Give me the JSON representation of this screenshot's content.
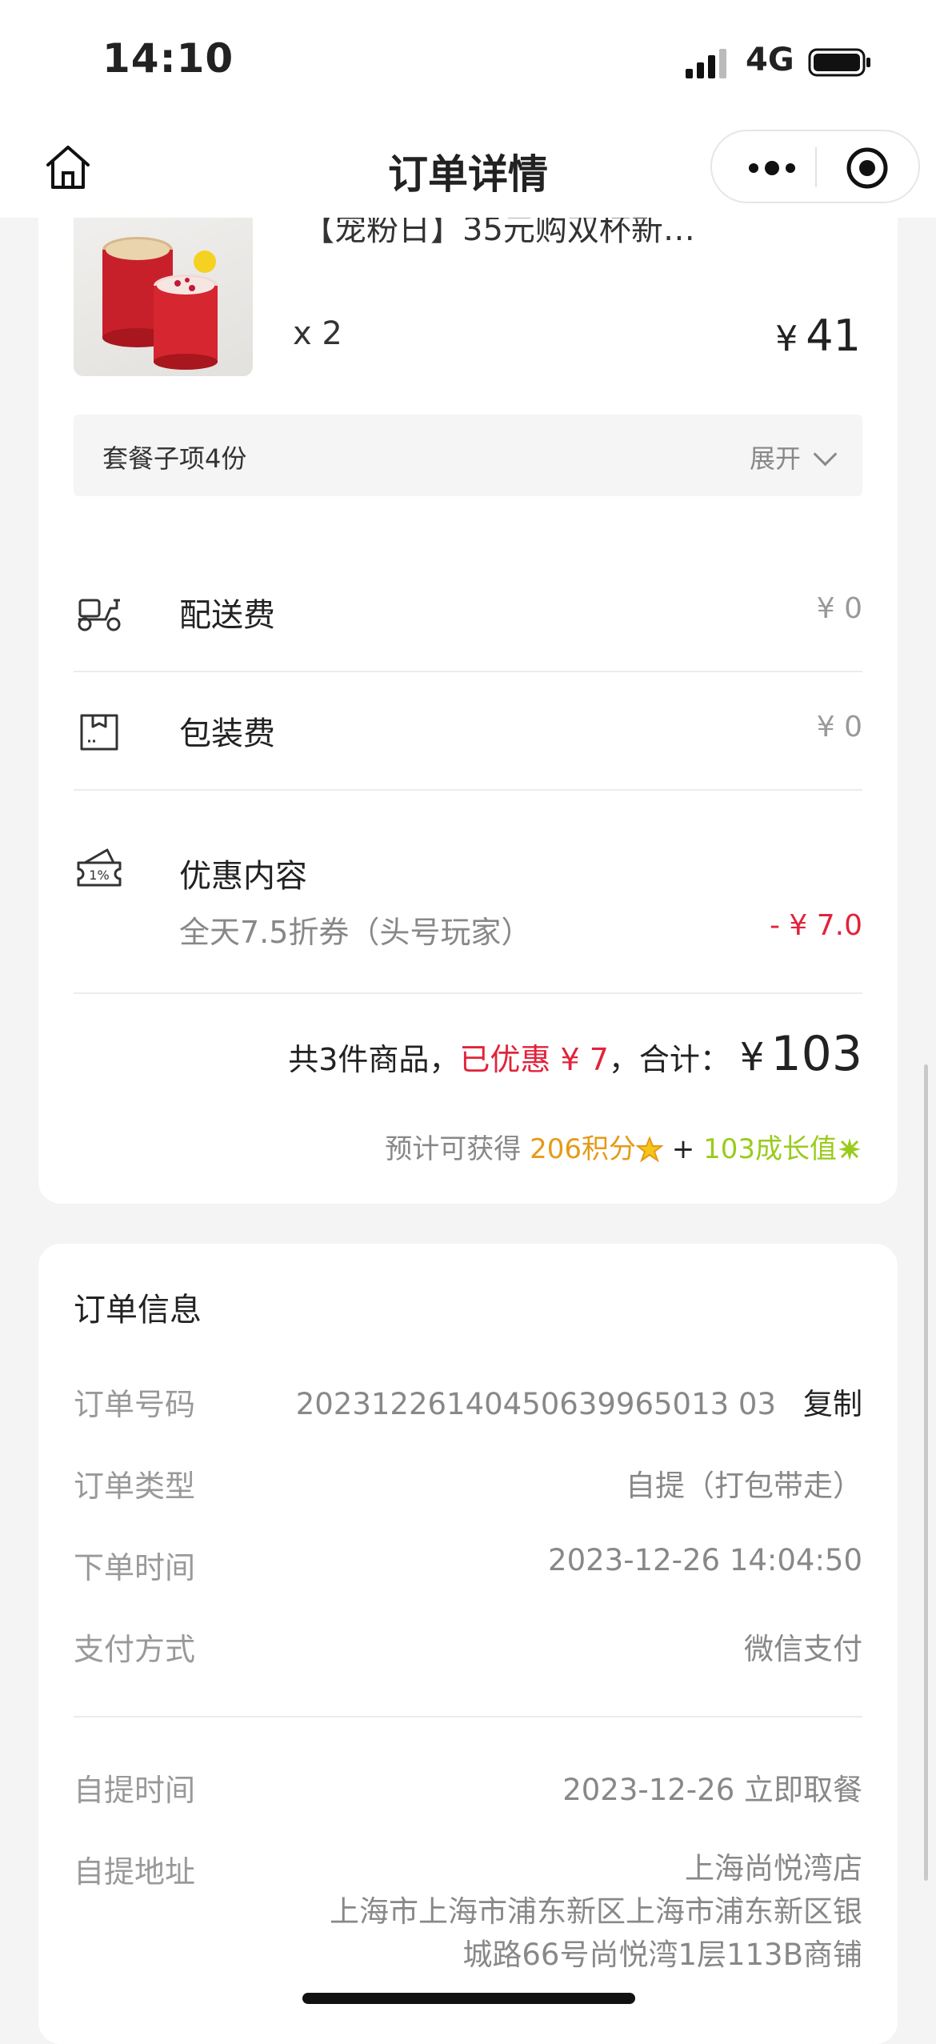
{
  "status_bar": {
    "time": "14:10",
    "network": "4G",
    "icons": [
      "signal-icon",
      "battery-icon"
    ]
  },
  "nav": {
    "title": "订单详情",
    "icons": [
      "home-icon",
      "more-icon",
      "target-icon"
    ]
  },
  "product": {
    "name": "【宠粉日】35元购双杯新…",
    "quantity": "x 2",
    "price_symbol": "¥",
    "price": "41",
    "image_label": "双杯饮品图片",
    "combo_label": "套餐子项4份",
    "combo_toggle": "展开"
  },
  "fees": [
    {
      "label": "配送费",
      "value": "¥ 0",
      "icon": "scooter-icon"
    },
    {
      "label": "包装费",
      "value": "¥ 0",
      "icon": "package-icon"
    }
  ],
  "discount": {
    "label": "优惠内容",
    "icon": "coupon-icon",
    "detail": "全天7.5折券（头号玩家）",
    "value": "- ¥ 7.0"
  },
  "summary": {
    "count_text": "共3件商品，",
    "saved_text": "已优惠 ¥ 7",
    "total_label": "，合计：",
    "total_symbol": "¥",
    "total_value": "103"
  },
  "rewards": {
    "prefix": "预计可获得 ",
    "points": "206积分",
    "plus": " + ",
    "growth": "103成长值"
  },
  "order_info": {
    "title": "订单信息",
    "rows": [
      {
        "label": "订单号码",
        "value": "20231226140450639965013 03",
        "action": "复制"
      },
      {
        "label": "订单类型",
        "value": "自提（打包带走）"
      },
      {
        "label": "下单时间",
        "value": "2023-12-26 14:04:50"
      },
      {
        "label": "支付方式",
        "value": "微信支付"
      }
    ],
    "pickup": [
      {
        "label": "自提时间",
        "value": "2023-12-26 立即取餐"
      },
      {
        "label": "自提地址",
        "lines": [
          "上海尚悦湾店",
          "上海市上海市浦东新区上海市浦东新区银",
          "城路66号尚悦湾1层113B商铺"
        ]
      }
    ]
  },
  "colors": {
    "accent_red": "#e2233b",
    "points_orange": "#e69a17",
    "growth_green": "#9acb1c"
  }
}
